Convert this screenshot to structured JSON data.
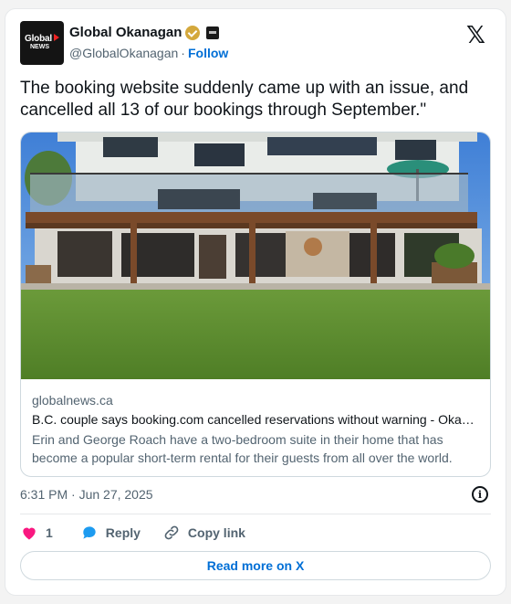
{
  "author": {
    "display_name": "Global Okanagan",
    "handle": "@GlobalOkanagan",
    "follow_label": "Follow",
    "avatar_line1": "Global",
    "avatar_line2": "NEWS",
    "verified_color": "#d4a83c"
  },
  "platform_icon": "x-logo",
  "tweet": {
    "text": "The booking website suddenly came up with an issue, and cancelled all 13 of our bookings through September.\""
  },
  "link_card": {
    "domain": "globalnews.ca",
    "headline": "B.C. couple says booking.com cancelled reservations without warning - Okanagan | Globalnews.ca",
    "description": "Erin and George Roach have a two-bedroom suite in their home that has become a popular short-term rental for their guests from all over the world."
  },
  "timestamp": "6:31 PM · Jun 27, 2025",
  "actions": {
    "like_count": "1",
    "reply_label": "Reply",
    "copy_label": "Copy link"
  },
  "read_more_label": "Read more on X",
  "colors": {
    "link_blue": "#006fd6",
    "like_pink": "#f91880",
    "reply_blue": "#1d9bf0",
    "muted_text": "#536471"
  }
}
